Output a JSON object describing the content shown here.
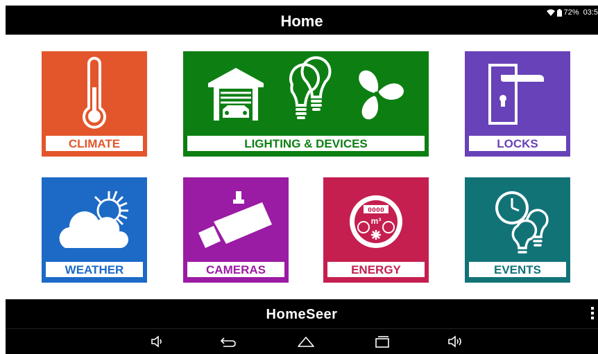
{
  "header": {
    "title": "Home"
  },
  "status_bar": {
    "battery": "72%",
    "time": "03:5"
  },
  "tiles": [
    {
      "label": "CLIMATE",
      "color": "#e3562b",
      "icon": "thermometer-icon"
    },
    {
      "label": "LIGHTING & DEVICES",
      "color": "#0d7f12",
      "icon": "garage-bulbs-fan-icon"
    },
    {
      "label": "LOCKS",
      "color": "#6842b8",
      "icon": "door-handle-lock-icon"
    },
    {
      "label": "WEATHER",
      "color": "#1c6ac6",
      "icon": "sun-cloud-icon"
    },
    {
      "label": "CAMERAS",
      "color": "#9a1ba4",
      "icon": "security-camera-icon"
    },
    {
      "label": "ENERGY",
      "color": "#c41f4f",
      "icon": "utility-meter-icon"
    },
    {
      "label": "EVENTS",
      "color": "#127377",
      "icon": "clock-bulbs-icon"
    }
  ],
  "energy_meter": {
    "digits": "0000",
    "unit": "m³"
  },
  "footer": {
    "logo": "HomeSeer"
  },
  "nav": [
    "volume-down-icon",
    "back-icon",
    "home-icon",
    "recents-icon",
    "volume-up-icon"
  ]
}
